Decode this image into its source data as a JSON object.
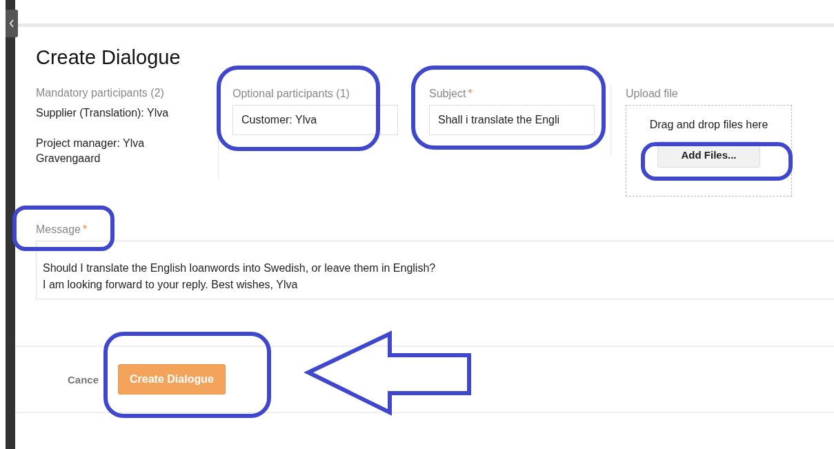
{
  "title": "Create Dialogue",
  "mandatory": {
    "label": "Mandatory participants (2)",
    "participants": [
      "Supplier (Translation): Ylva",
      "Project manager: Ylva Gravengaard"
    ]
  },
  "optional": {
    "label": "Optional participants (1)",
    "value": "Customer: Ylva"
  },
  "subject": {
    "label": "Subject",
    "mark": "*",
    "value": "Shall i translate the Engli"
  },
  "upload": {
    "label": "Upload file",
    "hint": "Drag and drop files here",
    "button": "Add Files..."
  },
  "message": {
    "label": "Message",
    "mark": "*",
    "lines": [
      "Should I translate the English loanwords into Swedish, or leave them in English?",
      "I am looking forward to your reply. Best wishes, Ylva"
    ]
  },
  "actions": [
    {
      "kind": "link",
      "label": "Cance"
    },
    {
      "kind": "primary",
      "label": "Create Dialogue"
    }
  ]
}
